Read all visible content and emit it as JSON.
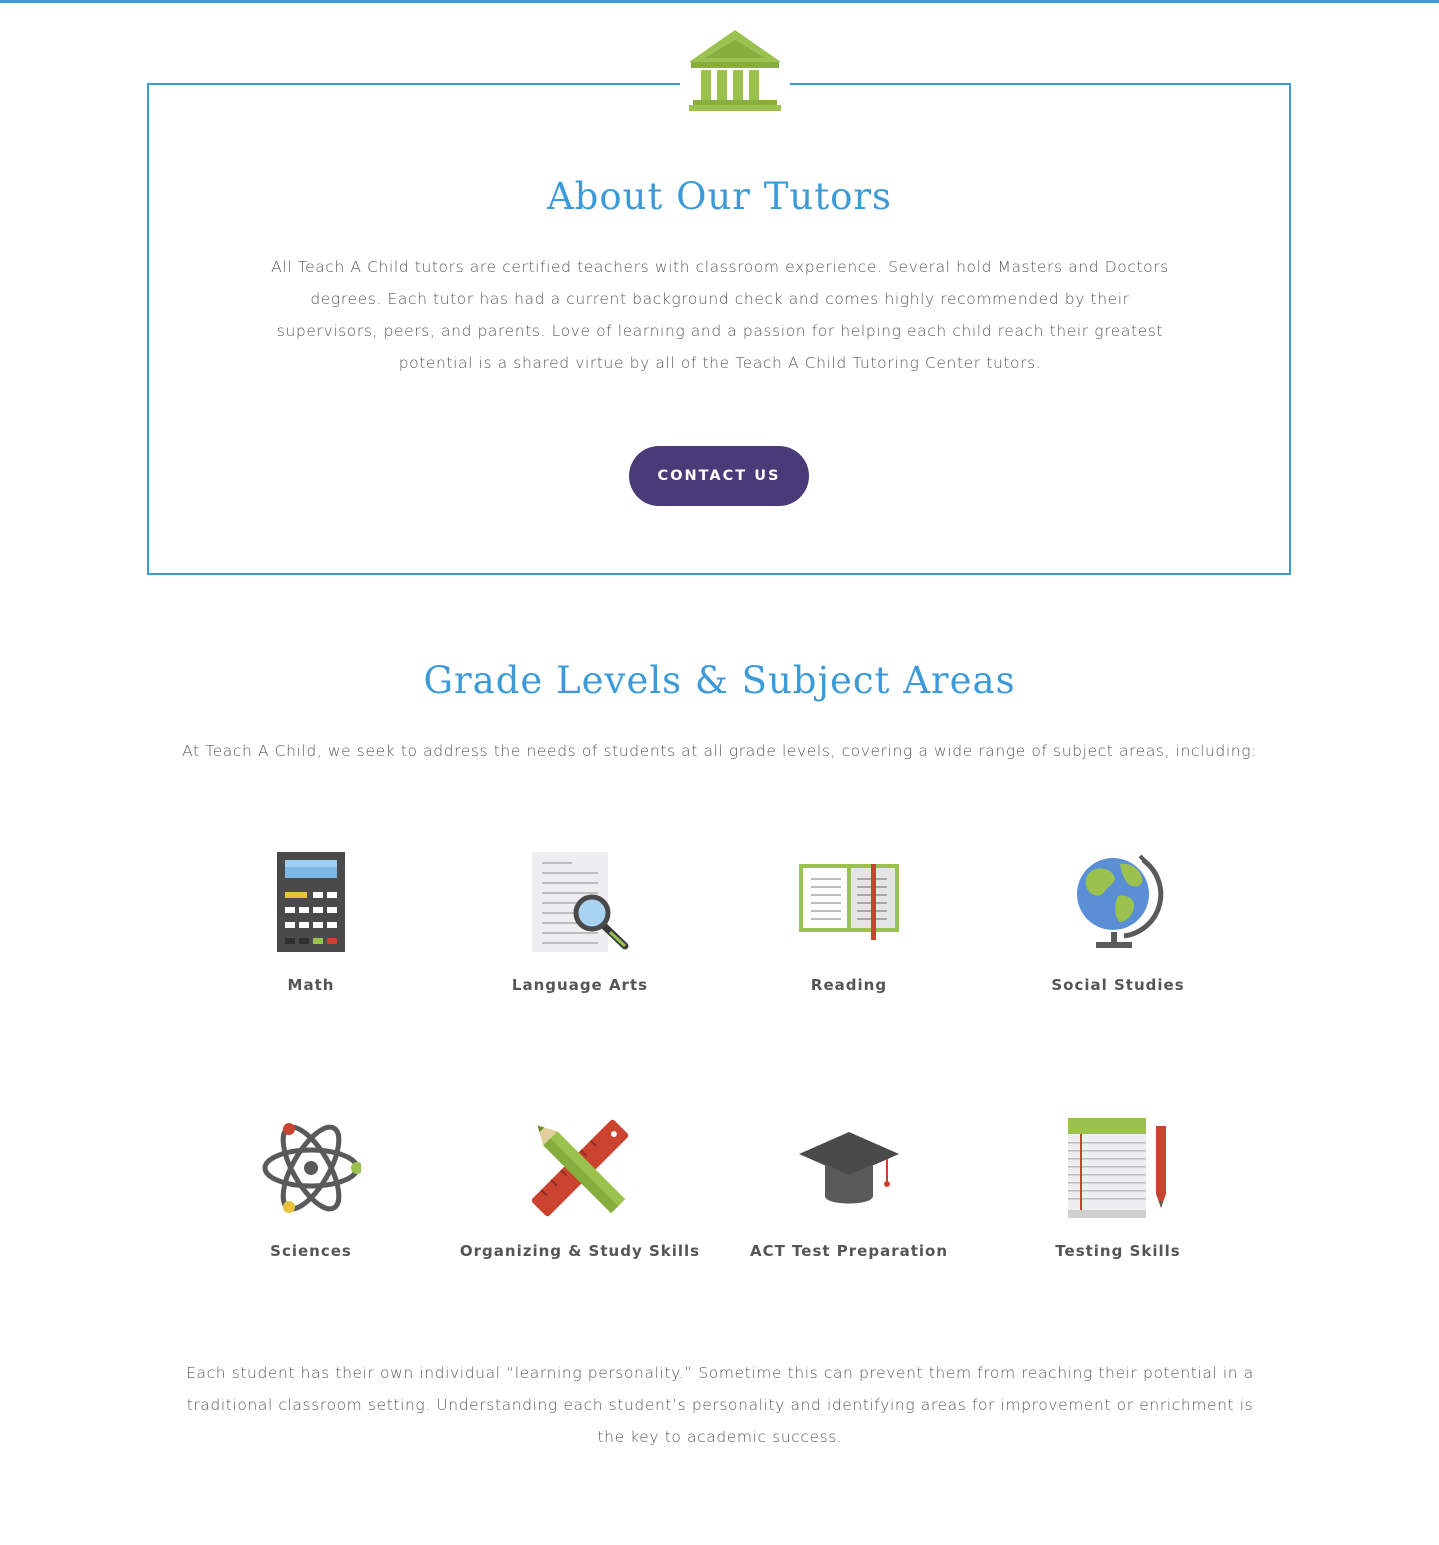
{
  "about": {
    "title": "About Our Tutors",
    "body": "All Teach A Child tutors are certified teachers with classroom experience. Several hold Masters and Doctors degrees. Each tutor has had a current background check and comes highly recommended by their supervisors, peers, and parents. Love of learning and a passion for helping each child reach their greatest potential is a shared virtue by all of the Teach A Child Tutoring Center tutors.",
    "button_label": "CONTACT US",
    "icon": "building-icon"
  },
  "grades": {
    "title": "Grade Levels & Subject Areas",
    "intro": "At Teach A Child, we seek to address the needs of students at all grade levels, covering a wide range of subject areas, including:",
    "subjects": [
      {
        "label": "Math",
        "icon": "calculator-icon"
      },
      {
        "label": "Language Arts",
        "icon": "document-search-icon"
      },
      {
        "label": "Reading",
        "icon": "open-book-icon"
      },
      {
        "label": "Social Studies",
        "icon": "globe-icon"
      },
      {
        "label": "Sciences",
        "icon": "atom-icon"
      },
      {
        "label": "Organizing & Study Skills",
        "icon": "pencil-ruler-icon"
      },
      {
        "label": "ACT Test Preparation",
        "icon": "graduation-cap-icon"
      },
      {
        "label": "Testing Skills",
        "icon": "notepad-pencil-icon"
      }
    ],
    "closing": "Each student has their own individual “learning personality.” Sometime this can prevent them from reaching their potential in a traditional classroom setting. Understanding each student’s personality and identifying areas for improvement or enrichment is the key to academic success."
  },
  "colors": {
    "accent_blue": "#3d9ad9",
    "button_purple": "#4a3a78",
    "icon_green": "#9bc24e"
  }
}
